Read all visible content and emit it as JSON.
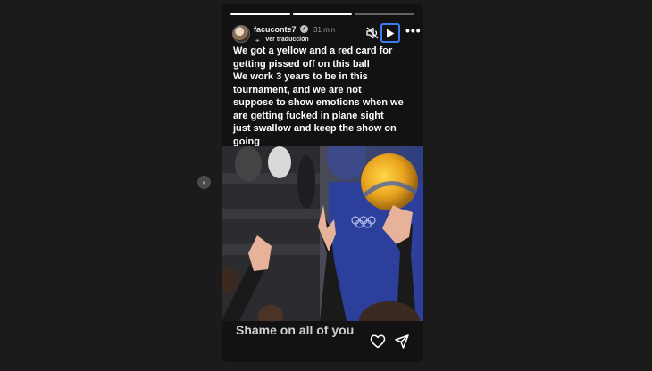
{
  "story": {
    "username": "facuconte7",
    "verified_icon": "verified-badge-icon",
    "time": "31 min",
    "translate_label": "Ver traducción",
    "caption": "We got a yellow and a red card for\ngetting pissed off on this ball\nWe work 3 years to be in this\ntournament, and we are not\nsuppose to show emotions when we\nare getting fucked in plane sight\njust swallow and keep the show on\ngoing",
    "overlay_text": "Shame on all of you",
    "progress_segments": 3,
    "progress_active": 2
  },
  "colors": {
    "background": "#1b1b1b",
    "story_bg": "#121212",
    "play_focus": "#3d7cf0"
  },
  "icons": {
    "prev": "chevron-left-icon",
    "mute": "speaker-muted-icon",
    "play": "play-icon",
    "more": "more-horizontal-icon",
    "like": "heart-icon",
    "share": "send-icon"
  }
}
